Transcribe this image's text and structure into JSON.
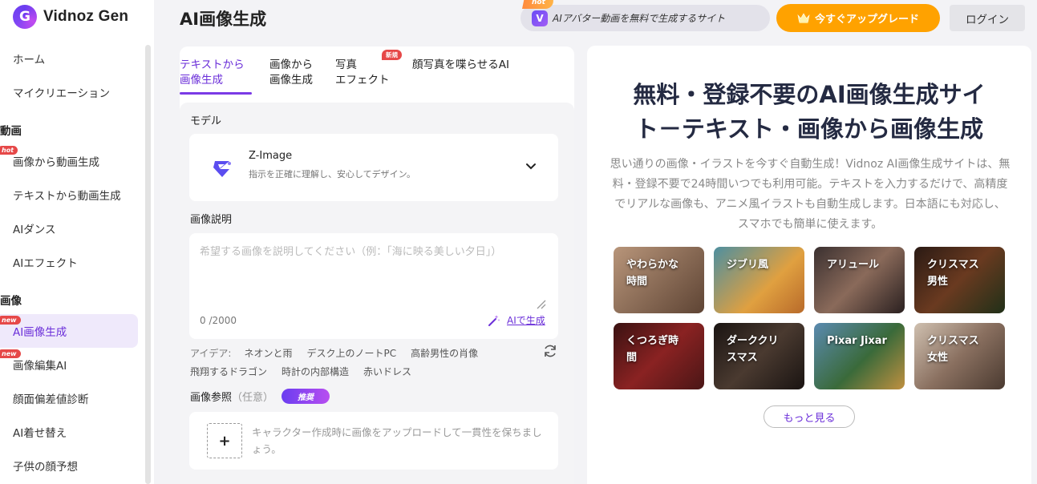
{
  "app": {
    "logo_text": "Vidnoz Gen",
    "logo_letter": "G"
  },
  "sidebar": {
    "items": [
      {
        "label": "ホーム"
      },
      {
        "label": "マイクリエーション"
      },
      {
        "section": "動画"
      },
      {
        "label": "画像から動画生成",
        "badge": "hot"
      },
      {
        "label": "テキストから動画生成"
      },
      {
        "label": "AIダンス"
      },
      {
        "label": "AIエフェクト"
      },
      {
        "section": "画像"
      },
      {
        "label": "AI画像生成",
        "badge": "new",
        "active": true
      },
      {
        "label": "画像編集AI",
        "badge": "new"
      },
      {
        "label": "顔面偏差値診断"
      },
      {
        "label": "AI着せ替え"
      },
      {
        "label": "子供の顔予想"
      }
    ]
  },
  "header": {
    "title": "AI画像生成",
    "promo_hot": "hot",
    "promo_icon": "V",
    "promo_text": "AIアバター動画を無料で生成するサイト",
    "upgrade_label": "今すぐアップグレード",
    "login_label": "ログイン"
  },
  "tabs": [
    {
      "line1": "テキストから",
      "line2": "画像生成",
      "active": true
    },
    {
      "line1": "画像から",
      "line2": "画像生成"
    },
    {
      "line1": "写真",
      "line2": "エフェクト",
      "badge": "新規"
    },
    {
      "line1": "顔写真を喋らせるAI",
      "line2": ""
    }
  ],
  "form": {
    "model_label": "モデル",
    "model_name": "Z-Image",
    "model_desc": "指示を正確に理解し、安心してデザイン。",
    "desc_label": "画像説明",
    "desc_placeholder": "希望する画像を説明してください（例：「海に映る美しい夕日」）",
    "counter": "0 /2000",
    "ai_generate": "AIで生成",
    "ideas_lead": "アイデア:",
    "ideas": [
      "ネオンと雨",
      "デスク上のノートPC",
      "高齢男性の肖像",
      "飛翔するドラゴン",
      "時計の内部構造",
      "赤いドレス"
    ],
    "ref_label": "画像参照",
    "ref_optional": "（任意）",
    "ref_badge": "推奨",
    "upload_plus": "+",
    "ref_text": "キャラクター作成時に画像をアップロードして一貫性を保ちましょう。"
  },
  "hero": {
    "title_line1": "無料・登録不要のAI画像生成サイ",
    "title_line2": "ト－テキスト・画像から画像生成",
    "description": "思い通りの画像・イラストを今すぐ自動生成！Vidnoz AI画像生成サイトは、無料・登録不要で24時間いつでも利用可能。テキストを入力するだけで、高精度でリアルな画像も、アニメ風イラストも自動生成します。日本語にも対応し、スマホでも簡単に使えます。",
    "cards": [
      {
        "label": "やわらかな\n時間",
        "bg": "#8a6a55"
      },
      {
        "label": "ジブリ風",
        "bg": "#c98a3a"
      },
      {
        "label": "アリュール",
        "bg": "#5a4a44"
      },
      {
        "label": "クリスマス\n男性",
        "bg": "#3a2a24"
      },
      {
        "label": "くつろぎ時\n間",
        "bg": "#6a2020"
      },
      {
        "label": "ダーククリ\nスマス",
        "bg": "#2b2220"
      },
      {
        "label": "Pixar Jixar",
        "bg": "#4d7fa8"
      },
      {
        "label": "クリスマス\n女性",
        "bg": "#9a8070"
      }
    ],
    "more_label": "もっと見る"
  }
}
